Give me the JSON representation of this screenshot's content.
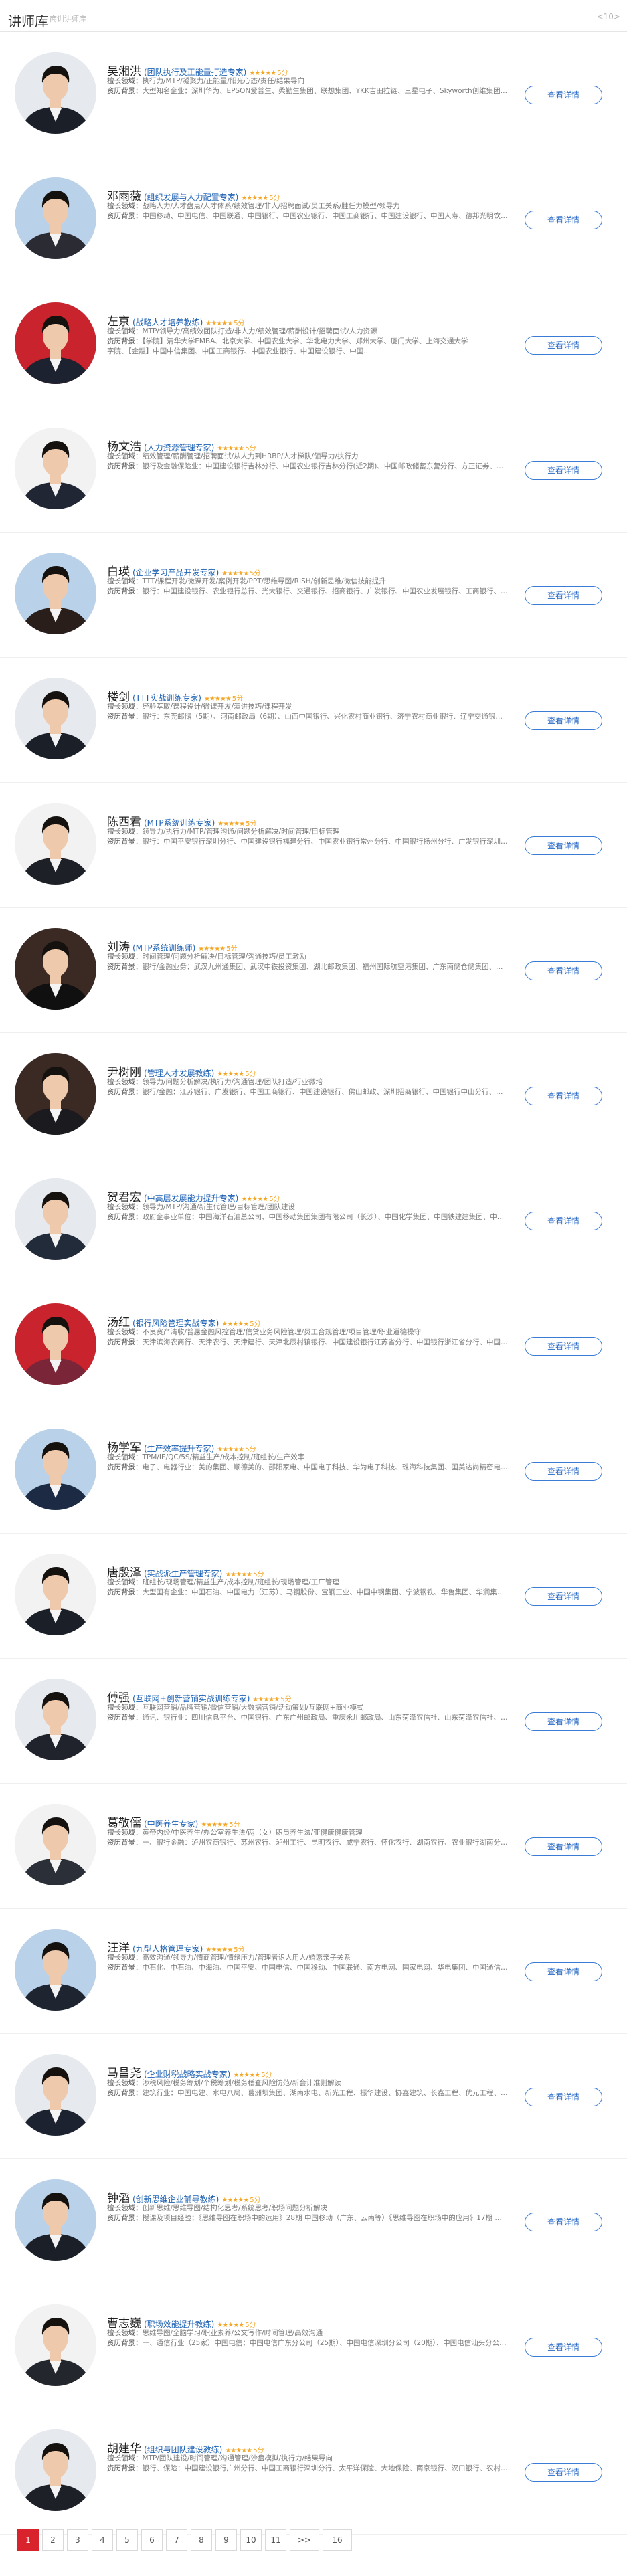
{
  "header": {
    "title": "讲师库",
    "subtitle": "商训讲师库",
    "page_indicator": "<10>"
  },
  "detail_label": "查看详情",
  "stars": "★★★★★",
  "photo_colors": {
    "bg1": "#e6e9ee",
    "bg2": "#b9d2ea",
    "bg3": "#c9242d",
    "bg4": "#f2f2f2",
    "bg5": "#3b2a24",
    "suit": "#1b1f28",
    "skin": "#efc9ac",
    "hair": "#14110f"
  },
  "lecturers": [
    {
      "name": "吴湘洪",
      "tag": "(团队执行及正能量打造专家)",
      "score": "5分",
      "lines": [
        {
          "label": "擅长领域：",
          "text": "执行力/MTP/凝聚力/正能量/阳光心态/责任/结果导向"
        },
        {
          "label": "资历背景：",
          "text": "大型知名企业：深圳华为、EPSON爱普生、柔勤生集团、联想集团、YKK吉田拉链、三星电子、Skyworth创维集团、松下电器、建光电子、康佳集团（东莞）、东莞立顿集团、TD..."
        }
      ]
    },
    {
      "name": "邓雨薇",
      "tag": "(组织发展与人力配置专家)",
      "score": "5分",
      "lines": [
        {
          "label": "擅长领域：",
          "text": "战略人力/人才盘点/人才体系/绩效管理/非人/招聘面试/员工关系/胜任力模型/领导力"
        },
        {
          "label": "资历背景：",
          "text": "中国移动、中国电信、中国联通、中国银行、中国农业银行、中国工商银行、中国建设银行、中国人寿、德邦光明饮料、南方航空、中国电信、欧派家居、创维集团、..."
        }
      ]
    },
    {
      "name": "左京",
      "tag": "(战略人才培养教练)",
      "score": "5分",
      "lines": [
        {
          "label": "擅长领域：",
          "text": "MTP/领导力/高绩效团队打造/非人力/绩效管理/薪酬设计/招聘面试/人力资源"
        },
        {
          "label": "资历背景：",
          "text": "【学院】清华大学EMBA、北京大学、中国农业大学、华北电力大学、郑州大学、厦门大学、上海交通大学"
        },
        {
          "label": "",
          "text": "字院、【金融】中国中信集团、中国工商银行、中国农业银行、中国建设银行、中国..."
        }
      ]
    },
    {
      "name": "杨文浩",
      "tag": "(人力资源管理专家)",
      "score": "5分",
      "lines": [
        {
          "label": "擅长领域：",
          "text": "绩效管理/薪酬管理/招聘面试/从人力到HRBP/人才梯队/领导力/执行力"
        },
        {
          "label": "资历背景：",
          "text": "银行及金融保险业：中国建设银行吉林分行、中国农业银行吉林分行(近2期)、中国邮政储蓄东营分行、方正证券、平安人寿、泰康人寿、辽宁省工商银行、辽宁省农业银行吉..."
        }
      ]
    },
    {
      "name": "白瑛",
      "tag": "(企业学习产品开发专家)",
      "score": "5分",
      "lines": [
        {
          "label": "擅长领域：",
          "text": "TTT/课程开发/微课开发/案例开发/PPT/思维导图/RISH/创新思维/微信技能提升"
        },
        {
          "label": "资历背景：",
          "text": "银行：中国建设银行、农业银行总行、光大银行、交通银行、招商银行、广发银行、中国农业发展银行、工商银行、中信银行、兴业银行广州分行、工商银行南京分行、工商..."
        }
      ]
    },
    {
      "name": "楼剑",
      "tag": "(TTT实战训练专家)",
      "score": "5分",
      "lines": [
        {
          "label": "擅长领域：",
          "text": "经验萃取/课程设计/微课开发/演讲技巧/课程开发"
        },
        {
          "label": "资历背景：",
          "text": "银行：东莞邮储（5期）、河南邮政局（6期）、山西中国银行、兴化农村商业银行、济宁农村商业银行、辽宁交通银行（7期）、中国邮储银行、安徽银行、太原工商银行、中国..."
        }
      ]
    },
    {
      "name": "陈西君",
      "tag": "(MTP系统训练专家)",
      "score": "5分",
      "lines": [
        {
          "label": "擅长领域：",
          "text": "领导力/执行力/MTP/管理沟通/问题分析解决/时间管理/目标管理"
        },
        {
          "label": "资历背景：",
          "text": "银行：中国平安银行深圳分行、中国建设银行福建分行、中国农业银行常州分行、中国银行扬州分行、广发银行深圳分行、长沙农业银行、深圳招商银行股份有限公司、江西赣州农..."
        }
      ]
    },
    {
      "name": "刘涛",
      "tag": "(MTP系统训练师)",
      "score": "5分",
      "lines": [
        {
          "label": "擅长领域：",
          "text": "时间管理/问题分析解决/目标管理/沟通技巧/员工激励"
        },
        {
          "label": "资历背景：",
          "text": "银行/金融业务：武汉九州通集团、武汉中铁投资集团、湖北邮政集团、福州国际航空港集团、广东南储仓储集团、中国电建集团、长江三峡集团、福建太平洋集团、中铁集团、江苏双..."
        }
      ]
    },
    {
      "name": "尹树刚",
      "tag": "(管理人才发展教练)",
      "score": "5分",
      "lines": [
        {
          "label": "擅长领域：",
          "text": "领导力/问题分析解决/执行力/沟通管理/团队打造/行业微培"
        },
        {
          "label": "资历背景：",
          "text": "银行/金融：江苏银行、广发银行、中国工商银行、中国建设银行、佛山邮政、深圳招商银行、中国银行中山分行、深圳中国邮政、南海农商行、河南农业银行、河南..."
        }
      ]
    },
    {
      "name": "贺君宏",
      "tag": "(中高层发展能力提升专家)",
      "score": "5分",
      "lines": [
        {
          "label": "擅长领域：",
          "text": "领导力/MTP/沟通/新生代管理/目标管理/团队建设"
        },
        {
          "label": "资历背景：",
          "text": "政府企事业单位：中国海洋石油总公司、中国移动集团集团有限公司（长沙）、中国化学集团、中国铁建建集团、中国石油国际公司、中国船舶集团、成都中铁建设集团、都市..."
        }
      ]
    },
    {
      "name": "汤红",
      "tag": "(银行风险管理实战专家)",
      "score": "5分",
      "lines": [
        {
          "label": "擅长领域：",
          "text": "不良资产清收/普惠金融风控管理/信贷业务风险管理/员工合规管理/项目管理/职业道德操守"
        },
        {
          "label": "资历背景：",
          "text": "天津滨海农商行、天津农行、天津建行、天津北辰村镇银行、中国建设银行江苏省分行、中国银行浙江省分行、中国银行江苏省分行、中国工商银行北京分行、中国银行..."
        }
      ]
    },
    {
      "name": "杨学军",
      "tag": "(生产效率提升专家)",
      "score": "5分",
      "lines": [
        {
          "label": "擅长领域：",
          "text": "TPM/IE/QC/5S/精益生产/成本控制/班组长/生产效率"
        },
        {
          "label": "资历背景：",
          "text": "电子、电器行业：美的集团、顺德美的、邵阳家电、中国电子科技、华为电子科技、珠海科技集团、国美达尚精密电子、方正集团、万机仪器、霍曼光电、机电集团、光电电子、惠州大亚..."
        }
      ]
    },
    {
      "name": "唐殷泽",
      "tag": "(实战派生产管理专家)",
      "score": "5分",
      "lines": [
        {
          "label": "擅长领域：",
          "text": "班组长/现场管理/精益生产/成本控制/班组长/现场管理/工厂管理"
        },
        {
          "label": "资历背景：",
          "text": "大型国有企业：中国石油、中国电力（江苏）、马钢股份、宝钢工业、中国中钢集团、宁波钢铁、华鲁集团、华润集团、中国重汽、华能集团、中国海洋石油、江苏美的、沈飞集团、苏化化..."
        }
      ]
    },
    {
      "name": "傅强",
      "tag": "(互联网+创新营销实战训练专家)",
      "score": "5分",
      "lines": [
        {
          "label": "擅长领域：",
          "text": "互联网营销/品牌营销/微信营销/大数据营销/活动策划/互联网+商业模式"
        },
        {
          "label": "资历背景：",
          "text": "通讯、银行业：四川信息平台、中国银行、广东广州邮政局、重庆永川邮政局、山东菏泽农信社、山东菏泽农信社、湖南长沙农信社、广东韶关农信社、四川绵阳农信社、内蒙古赤峰农信..."
        }
      ]
    },
    {
      "name": "葛敬儒",
      "tag": "(中医养生专家)",
      "score": "5分",
      "lines": [
        {
          "label": "擅长领域：",
          "text": "黄帝内经/中医养生/办公室养生法/两（女）职员养生法/亚健康健康管理"
        },
        {
          "label": "资历背景：",
          "text": "一、银行金融：泸州农商银行、苏州农行、泸州工行、昆明农行、咸宁农行、怀化农行、湖南农行、农业银行湖南分行、中国银行成都分行、江苏省农行、建设银行福州分行、湖..."
        }
      ]
    },
    {
      "name": "汪洋",
      "tag": "(九型人格管理专家)",
      "score": "5分",
      "lines": [
        {
          "label": "擅长领域：",
          "text": "高效沟通/领导力/情商管理/情绪压力/管理者识人用人/婚恋亲子关系"
        },
        {
          "label": "资历背景：",
          "text": "中石化、中石油、中海油、中国平安、中国电信、中国移动、中国联通、南方电网、国家电网、华电集团、中国通信服务、东风汽车、万机仪器、康佳集团、工商银行、湖南长沙..."
        }
      ]
    },
    {
      "name": "马昌尧",
      "tag": "(企业财税战略实战专家)",
      "score": "5分",
      "lines": [
        {
          "label": "擅长领域：",
          "text": "涉税风险/税务筹划/个税筹划/税务稽查风险防范/新会计准则解读"
        },
        {
          "label": "资历背景：",
          "text": "建筑行业：中国电建、水电八局、葛洲坝集团、湖南水电、新光工程、振华建设、协鑫建筑、长鑫工程、优元工程、丰汇建筑、隆顺建筑、浩发建筑、康城建筑、鸿玛工程、九和建..."
        }
      ]
    },
    {
      "name": "钟滔",
      "tag": "(创新思维企业辅导教练)",
      "score": "5分",
      "lines": [
        {
          "label": "擅长领域：",
          "text": "创新思维/思维导图/结构化思考/系统思考/职场问题分析解决"
        },
        {
          "label": "资历背景：",
          "text": "授课及项目经验：《思维导图在职场中的运用》28期 中国移动（广东、云南等）《思维导图在职场中的应用》17期 东亚银行《创新思维训练》8期 多个..."
        }
      ]
    },
    {
      "name": "曹志巍",
      "tag": "(职场效能提升教练)",
      "score": "5分",
      "lines": [
        {
          "label": "擅长领域：",
          "text": "思维导图/全脑学习/职业素养/公文写作/时间管理/高效沟通"
        },
        {
          "label": "资历背景：",
          "text": "一、通信行业（25家）中国电信：中国电信广东分公司（25期）、中国电信深圳分公司（20期）、中国电信汕头分公司（6期）、中国电信肇庆分公司（5期）、中国电信韶关分..."
        }
      ]
    },
    {
      "name": "胡建华",
      "tag": "(组织与团队建设教练)",
      "score": "5分",
      "lines": [
        {
          "label": "擅长领域：",
          "text": "MTP/团队建设/时间管理/沟通管理/沙盘模拟/执行力/结果导向"
        },
        {
          "label": "资历背景：",
          "text": "银行、保险：中国建设银行广州分行、中国工商银行深圳分行、太平洋保险、大地保险、南京银行、汉口银行、农村商业银行、如东农村商业银行、青海大通商业银行、..."
        }
      ]
    }
  ],
  "pagination": {
    "pages": [
      "1",
      "2",
      "3",
      "4",
      "5",
      "6",
      "7",
      "8",
      "9",
      "10",
      "11"
    ],
    "active": "1",
    "next": ">>",
    "last": "16"
  }
}
